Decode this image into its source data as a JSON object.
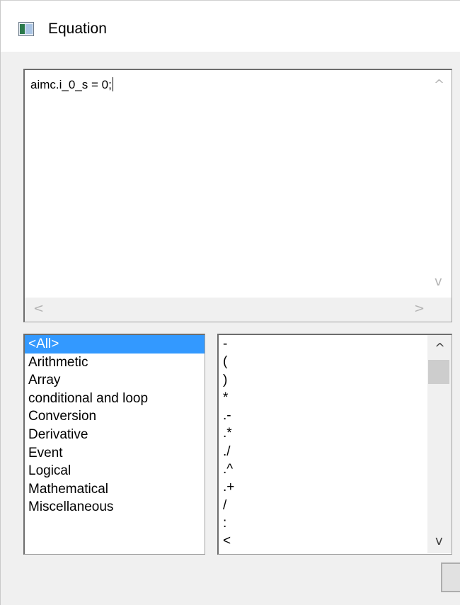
{
  "window": {
    "title": "Equation",
    "icon": "window-app-icon"
  },
  "editor": {
    "text": "aimc.i_0_s = 0;",
    "scroll_up": "^",
    "scroll_down": "v",
    "scroll_left": "<",
    "scroll_right": ">"
  },
  "categories": {
    "items": [
      "<All>",
      "Arithmetic",
      "Array",
      "conditional and loop",
      "Conversion",
      "Derivative",
      "Event",
      "Logical",
      "Mathematical",
      "Miscellaneous"
    ],
    "selected": "<All>"
  },
  "operators": {
    "items": [
      "-",
      "(",
      ")",
      "*",
      ".-",
      ".*",
      "./",
      ".^",
      ".+",
      "/",
      ":",
      "<"
    ],
    "scroll_up": "^",
    "scroll_down": "v"
  }
}
